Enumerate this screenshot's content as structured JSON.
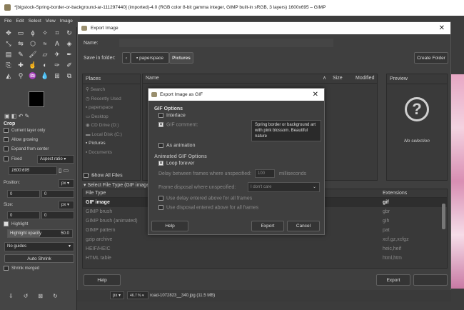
{
  "window": {
    "title": "*[bigstock-Spring-border-or-background-ar-111297440] (imported)-4.0 (RGB color 8-bit gamma integer, GIMP built-in sRGB, 3 layers) 1600x695 – GIMP"
  },
  "menu": [
    "File",
    "Edit",
    "Select",
    "View",
    "Image"
  ],
  "toolbox": {
    "tool_options_title": "Crop",
    "current_layer_only": "Current layer only",
    "allow_growing": "Allow growing",
    "expand_from_center": "Expand from center",
    "fixed_label": "Fixed",
    "aspect_ratio": "Aspect ratio",
    "ratio_value": "1600:695",
    "position_label": "Position:",
    "size_label": "Size:",
    "unit": "px",
    "pos_x": "0",
    "pos_y": "0",
    "size_x": "0",
    "size_y": "0",
    "highlight_label": "Highlight",
    "highlight_opacity_label": "Highlight opacity",
    "highlight_opacity_value": "50.0",
    "guides": "No guides",
    "auto_shrink": "Auto Shrink",
    "shrink_merged": "Shrink merged"
  },
  "export": {
    "title": "Export Image",
    "name_label": "Name:",
    "save_in_label": "Save in folder:",
    "crumbs": [
      "paperspace",
      "Pictures"
    ],
    "create_folder": "Create Folder",
    "places_header": "Places",
    "places": [
      "Search",
      "Recently Used",
      "paperspace",
      "Desktop",
      "CD Drive (D:)",
      "Local Disk (C:)",
      "Pictures",
      "Documents"
    ],
    "cols": {
      "name": "Name",
      "size": "Size",
      "modified": "Modified"
    },
    "preview_header": "Preview",
    "no_selection": "No selection",
    "show_all": "Show All Files",
    "select_type": "Select File Type (GIF image)",
    "ft_headers": {
      "type": "File Type",
      "ext": "Extensions"
    },
    "file_types": [
      {
        "type": "GIF image",
        "ext": "gif"
      },
      {
        "type": "GIMP brush",
        "ext": "gbr"
      },
      {
        "type": "GIMP brush (animated)",
        "ext": "gih"
      },
      {
        "type": "GIMP pattern",
        "ext": "pat"
      },
      {
        "type": "gzip archive",
        "ext": "xcf.gz,xcfgz"
      },
      {
        "type": "HEIF/HEIC",
        "ext": "heic,heif"
      },
      {
        "type": "HTML table",
        "ext": "html,htm"
      }
    ],
    "help": "Help",
    "export_btn": "Export"
  },
  "gif": {
    "title": "Export Image as GIF",
    "options_header": "GIF Options",
    "interlace": "Interlace",
    "gif_comment": "GIF comment:",
    "comment_text": "Spring border or background art with pink blossom. Beautiful nature",
    "as_animation": "As animation",
    "anim_header": "Animated GIF Options",
    "loop_forever": "Loop forever",
    "delay_label": "Delay between frames where unspecified:",
    "delay_value": "100",
    "delay_unit": "milliseconds",
    "disposal_label": "Frame disposal where unspecified:",
    "disposal_value": "I don't care",
    "use_delay": "Use delay entered above for all frames",
    "use_disposal": "Use disposal entered above for all frames",
    "help": "Help",
    "export": "Export",
    "cancel": "Cancel"
  },
  "status": {
    "unit": "px",
    "zoom": "46.7 %",
    "file": "road-1072823__340.jpg (11.5 MB)"
  }
}
